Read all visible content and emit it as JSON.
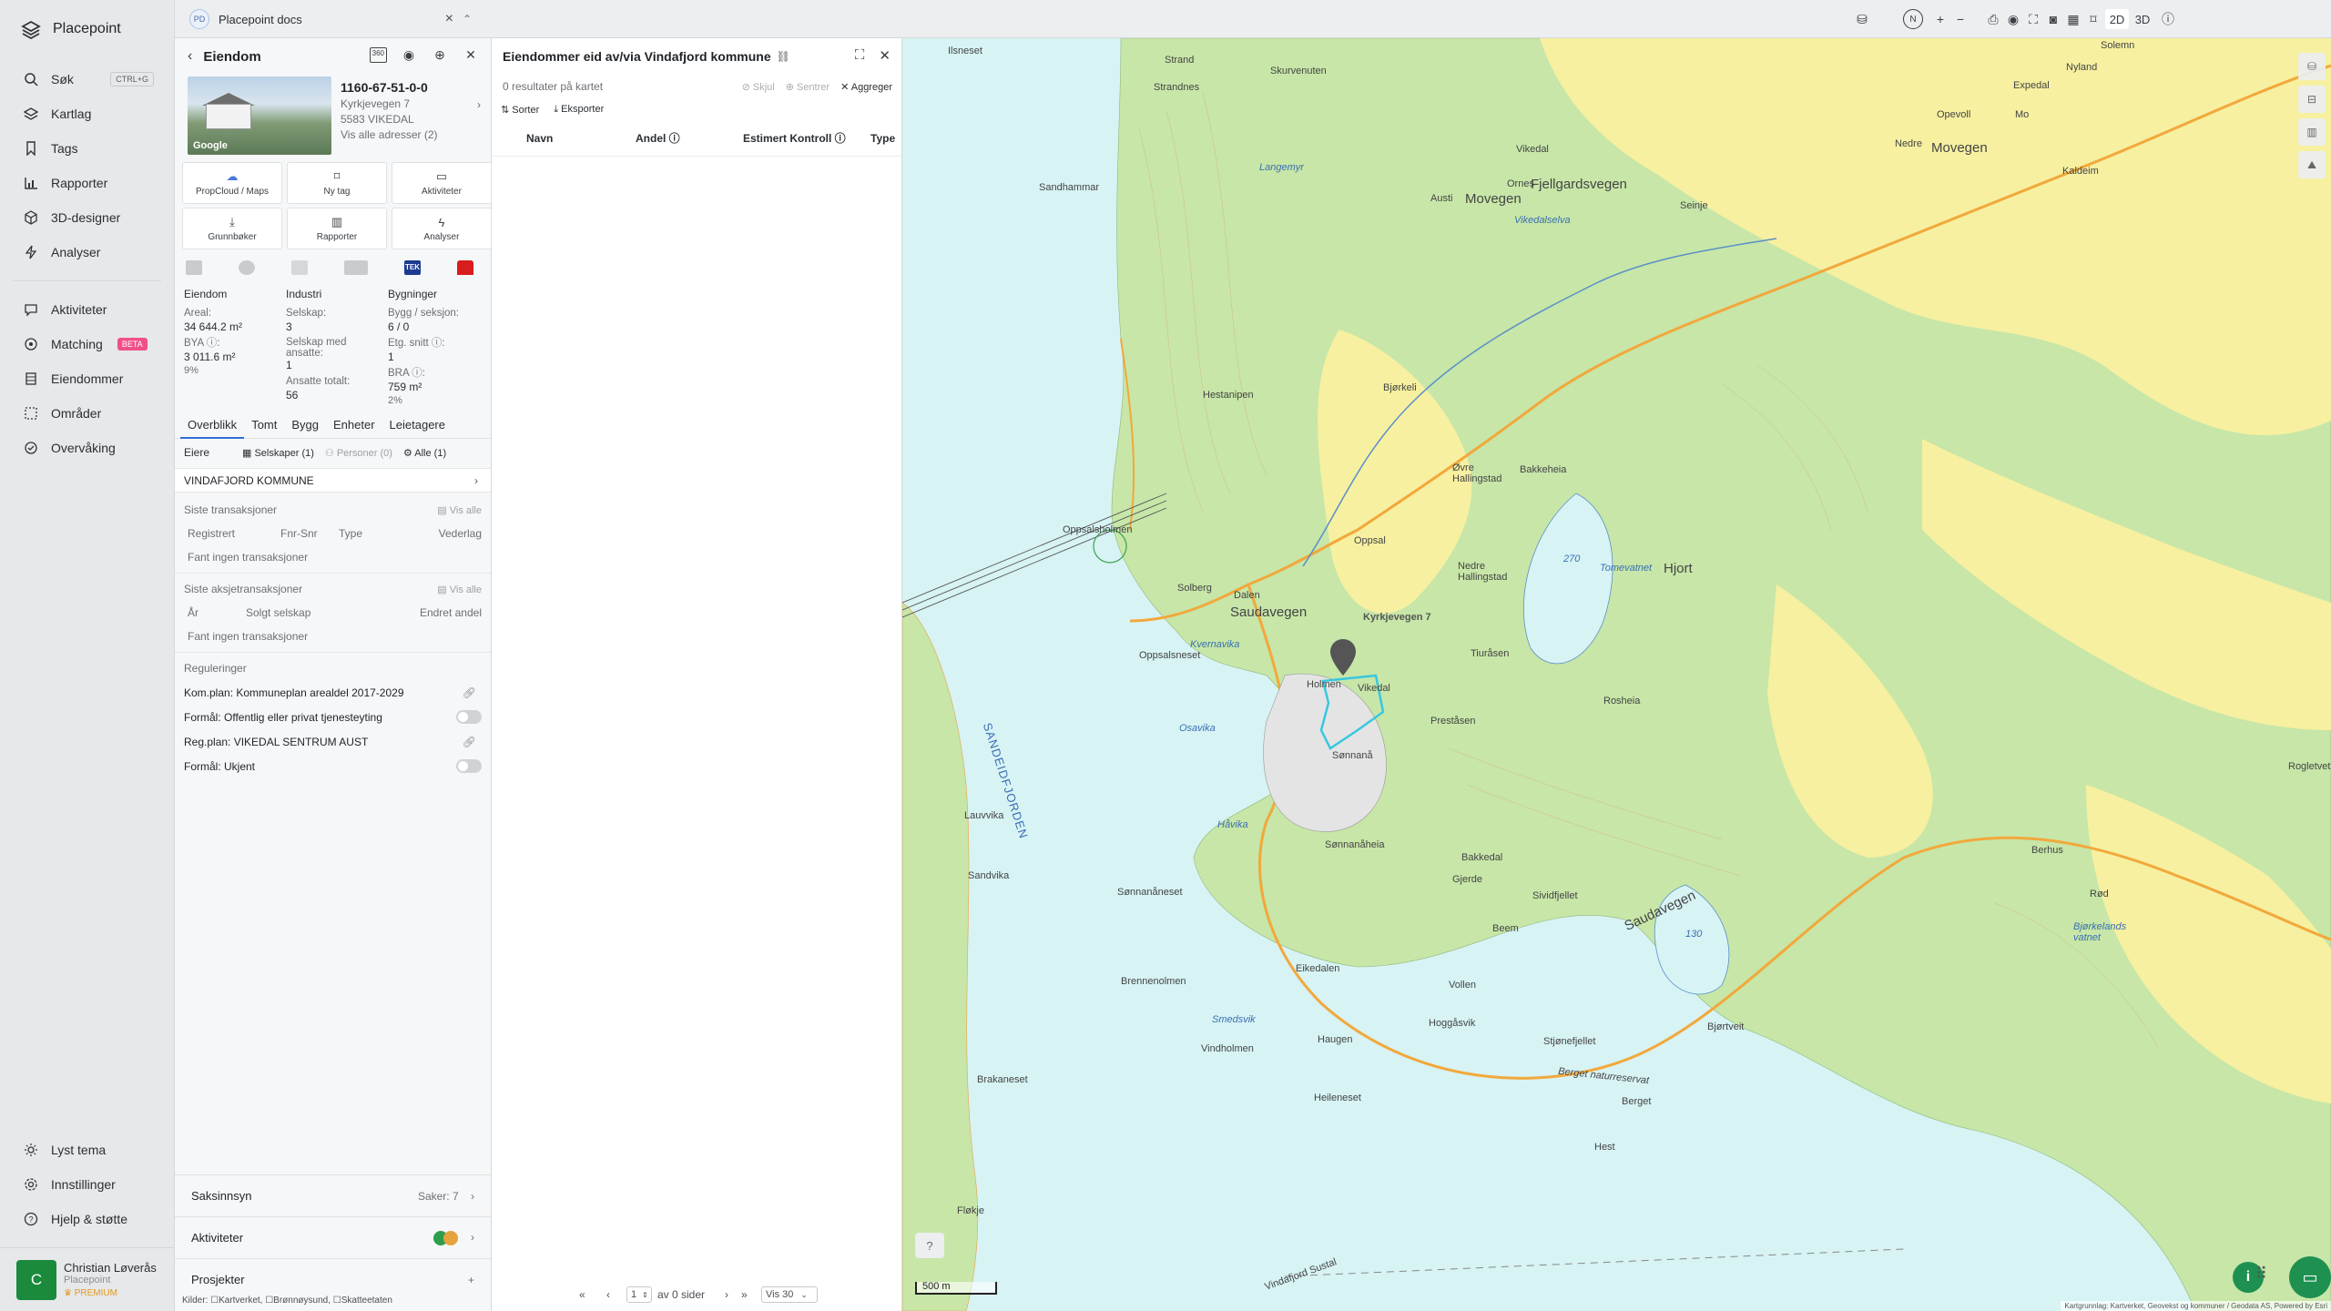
{
  "nav": {
    "brand": "Placepoint",
    "items": [
      {
        "label": "Søk",
        "icon": "search-icon",
        "shortcut": "CTRL+G"
      },
      {
        "label": "Kartlag",
        "icon": "layers-icon"
      },
      {
        "label": "Tags",
        "icon": "bookmark-icon"
      },
      {
        "label": "Rapporter",
        "icon": "chart-icon"
      },
      {
        "label": "3D-designer",
        "icon": "cube-icon"
      },
      {
        "label": "Analyser",
        "icon": "bolt-icon"
      }
    ],
    "items2": [
      {
        "label": "Aktiviteter",
        "icon": "chat-icon"
      },
      {
        "label": "Matching",
        "icon": "target-icon",
        "badge": "BETA"
      },
      {
        "label": "Eiendommer",
        "icon": "building-icon"
      },
      {
        "label": "Områder",
        "icon": "area-icon"
      },
      {
        "label": "Overvåking",
        "icon": "monitor-icon"
      }
    ],
    "bottom": [
      {
        "label": "Lyst tema",
        "icon": "sun-icon"
      },
      {
        "label": "Innstillinger",
        "icon": "gear-icon"
      },
      {
        "label": "Hjelp & støtte",
        "icon": "help-icon"
      }
    ],
    "user": {
      "initial": "C",
      "name": "Christian Løverås",
      "org": "Placepoint",
      "plan": "PREMIUM"
    }
  },
  "tab": {
    "badge": "PD",
    "label": "Placepoint docs"
  },
  "property": {
    "title": "Eiendom",
    "street_view": "360",
    "id": "1160-67-51-0-0",
    "address": "Kyrkjevegen 7",
    "postal": "5583 VIKEDAL",
    "all_addresses": "Vis alle adresser (2)",
    "photo_credit": "Google",
    "buttons": [
      {
        "label": "PropCloud / Maps",
        "icon": "cloud-icon"
      },
      {
        "label": "Ny tag",
        "icon": "bookmark-icon"
      },
      {
        "label": "Aktiviteter",
        "icon": "chat-icon"
      },
      {
        "label": "Grunnbøker",
        "icon": "download-icon"
      },
      {
        "label": "Rapporter",
        "icon": "chart-icon"
      },
      {
        "label": "Analyser",
        "icon": "bolt-icon"
      }
    ],
    "tek_label": "TEK",
    "stats": {
      "eiendom": {
        "title": "Eiendom",
        "areal_label": "Areal:",
        "areal": "34 644.2 m²",
        "bya_label": "BYA ⓘ:",
        "bya": "3 011.6 m²",
        "bya_pct": "9%"
      },
      "industri": {
        "title": "Industri",
        "selskap_label": "Selskap:",
        "selskap": "3",
        "ansatte_label": "Selskap med ansatte:",
        "ansatte": "1",
        "totalt_label": "Ansatte totalt:",
        "totalt": "56"
      },
      "bygninger": {
        "title": "Bygninger",
        "bygg_label": "Bygg / seksjon:",
        "bygg": "6 / 0",
        "etg_label": "Etg. snitt ⓘ:",
        "etg": "1",
        "bra_label": "BRA ⓘ:",
        "bra": "759 m²",
        "bra_pct": "2%"
      }
    },
    "tabs": [
      "Overblikk",
      "Tomt",
      "Bygg",
      "Enheter",
      "Leietagere"
    ],
    "owners": {
      "label": "Eiere",
      "selskaper": "Selskaper (1)",
      "personer": "Personer (0)",
      "alle": "Alle (1)",
      "owner_name": "VINDAFJORD KOMMUNE"
    },
    "transactions": {
      "title": "Siste transaksjoner",
      "vis_alle": "Vis alle",
      "cols": [
        "Registrert",
        "Fnr-Snr",
        "Type",
        "Vederlag"
      ],
      "empty": "Fant ingen transaksjoner"
    },
    "share_tx": {
      "title": "Siste aksjetransaksjoner",
      "vis_alle": "Vis alle",
      "cols": [
        "År",
        "Solgt selskap",
        "Endret andel"
      ],
      "empty": "Fant ingen transaksjoner"
    },
    "regulations": {
      "title": "Reguleringer",
      "items": [
        "Kom.plan: Kommuneplan arealdel 2017-2029",
        "Formål: Offentlig eller privat tjenesteyting",
        "Reg.plan: VIKEDAL SENTRUM AUST",
        "Formål: Ukjent"
      ]
    },
    "accordions": [
      {
        "label": "Saksinnsyn",
        "right": "Saker: 7"
      },
      {
        "label": "Aktiviteter",
        "right": ""
      },
      {
        "label": "Prosjekter",
        "right": "+"
      }
    ],
    "sources": "Kilder: ☐Kartverket, ☐Brønnøysund, ☐Skatteetaten"
  },
  "owned": {
    "title": "Eiendommer eid av/via Vindafjord kommune",
    "result": "0 resultater på kartet",
    "hide": "Skjul",
    "center": "Sentrer",
    "aggregate": "Aggreger",
    "sort": "Sorter",
    "export": "Eksporter",
    "cols": [
      "Navn",
      "Andel ⓘ",
      "Estimert Kontroll ⓘ",
      "Type"
    ],
    "pager": {
      "page": "1",
      "of": "av 0 sider",
      "show": "Vis 30"
    }
  },
  "toolbar": {
    "north": "N",
    "plus": "+",
    "minus": "−",
    "mode2d": "2D",
    "mode3d": "3D"
  },
  "map": {
    "labels": [
      {
        "t": "Ilsneset"
      },
      {
        "t": "Strand"
      },
      {
        "t": "Skurvenuten"
      },
      {
        "t": "Strandnes"
      },
      {
        "t": "Solemn"
      },
      {
        "t": "Nyland"
      },
      {
        "t": "Expedal"
      },
      {
        "t": "Opevoll"
      },
      {
        "t": "Mo"
      },
      {
        "t": "Nedre"
      },
      {
        "t": "Vikedal"
      },
      {
        "t": "Movegen"
      },
      {
        "t": "Kaldeim"
      },
      {
        "t": "Langemyr"
      },
      {
        "t": "Sandhammar"
      },
      {
        "t": "Austi"
      },
      {
        "t": "Ornes"
      },
      {
        "t": "Movegen"
      },
      {
        "t": "Fjellgardsvegen"
      },
      {
        "t": "Seinje"
      },
      {
        "t": "Vikedalselva"
      },
      {
        "t": "Hestanipen"
      },
      {
        "t": "Bjørkeli"
      },
      {
        "t": "Øvre Hallingstad"
      },
      {
        "t": "Bakkeheia"
      },
      {
        "t": "Oppsalsholmen"
      },
      {
        "t": "Oppsal"
      },
      {
        "t": "Nedre Hallingstad"
      },
      {
        "t": "270"
      },
      {
        "t": "Tomevatnet"
      },
      {
        "t": "Hjort"
      },
      {
        "t": "Solberg"
      },
      {
        "t": "Dalen"
      },
      {
        "t": "Saudavegen"
      },
      {
        "t": "Kyrkjevegen 7"
      },
      {
        "t": "Oppsalsneset"
      },
      {
        "t": "Kvernavika"
      },
      {
        "t": "Tiuråsen"
      },
      {
        "t": "Holmen"
      },
      {
        "t": "Vikedal"
      },
      {
        "t": "SANDEIDFJORDEN"
      },
      {
        "t": "Osavika"
      },
      {
        "t": "Preståsen"
      },
      {
        "t": "Rosheia"
      },
      {
        "t": "Rogletvet"
      },
      {
        "t": "Sønnanå"
      },
      {
        "t": "Håvika"
      },
      {
        "t": "Lauvvika"
      },
      {
        "t": "Sønnanåheia"
      },
      {
        "t": "Bakkedal"
      },
      {
        "t": "Sandvika"
      },
      {
        "t": "Gjerde"
      },
      {
        "t": "Sønnanåneset"
      },
      {
        "t": "Sividfjellet"
      },
      {
        "t": "Saudavegen"
      },
      {
        "t": "Berhus"
      },
      {
        "t": "Rød"
      },
      {
        "t": "Bjørkelands vatnet"
      },
      {
        "t": "130"
      },
      {
        "t": "Beem"
      },
      {
        "t": "Eikedalen"
      },
      {
        "t": "Brennenolmen"
      },
      {
        "t": "Vollen"
      },
      {
        "t": "Smedsvik"
      },
      {
        "t": "Hoggåsvik"
      },
      {
        "t": "Stjønefjellet"
      },
      {
        "t": "Bjørtveit"
      },
      {
        "t": "Vindholmen"
      },
      {
        "t": "Haugen"
      },
      {
        "t": "Berget naturreservat"
      },
      {
        "t": "Brakaneset"
      },
      {
        "t": "Heileneset"
      },
      {
        "t": "Berget"
      },
      {
        "t": "Hest"
      },
      {
        "t": "Fløkje"
      },
      {
        "t": "Vindafjord Sustal"
      }
    ],
    "scale": "500 m",
    "attribution": "Kartgrunnlag: Kartverket, Geovekst og kommuner / Geodata AS, Powered by Esri",
    "colors": {
      "water": "#d7f3f4",
      "forest": "#c7e6a8",
      "farmland": "#f6f0a0",
      "road": "#f2a83b"
    }
  }
}
